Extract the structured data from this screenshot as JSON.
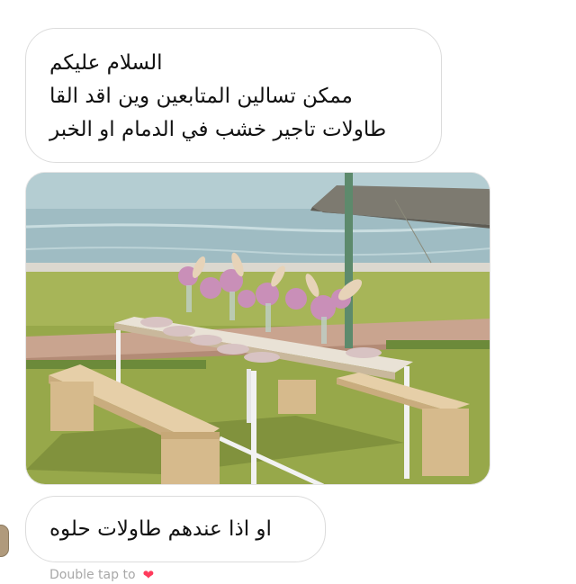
{
  "messages": {
    "first": {
      "lines": [
        "السلام عليكم",
        "ممكن تسالين المتابعين وين اقد القا",
        "طاولات تاجير خشب في الدمام او الخبر"
      ]
    },
    "second": {
      "text": "او اذا عندهم طاولات حلوه"
    }
  },
  "reaction": {
    "label": "Double tap to",
    "icon": "heart-icon"
  },
  "colors": {
    "bubble_border": "#dcdcdc",
    "heart": "#ff3b5c",
    "muted_text": "#a8a8a8"
  }
}
